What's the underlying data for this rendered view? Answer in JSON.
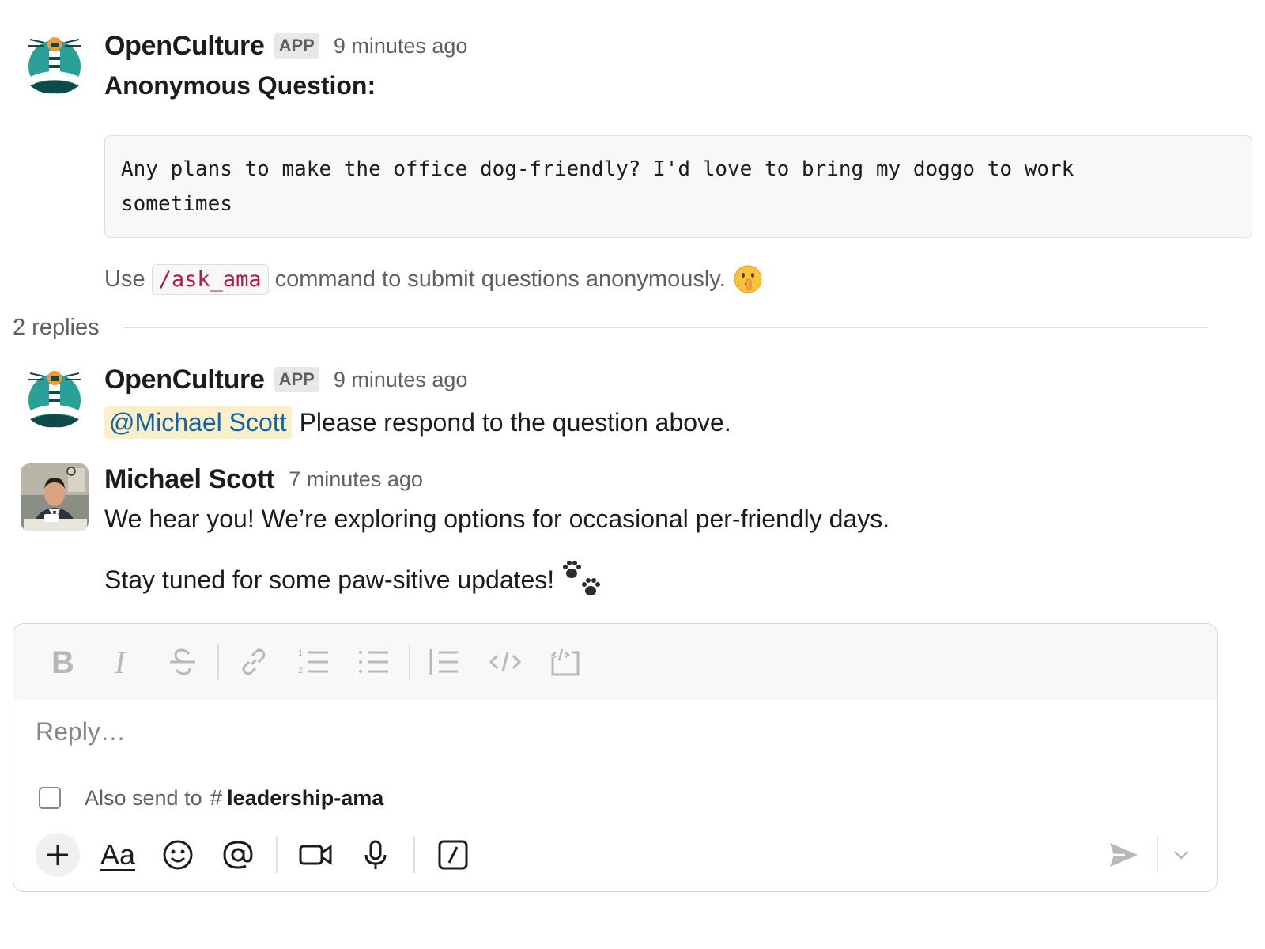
{
  "thread": {
    "messages": [
      {
        "sender": "OpenCulture",
        "badge": "APP",
        "timestamp": "9 minutes ago",
        "title": "Anonymous Question:",
        "code_line1": "Any plans to make the office dog-friendly? I'd love to bring my doggo to work",
        "code_line2": "sometimes",
        "hint_prefix": "Use",
        "hint_command": "/ask_ama",
        "hint_suffix": "command to submit questions anonymously.",
        "hint_emoji": "shushing-face-emoji"
      },
      {
        "sender": "OpenCulture",
        "badge": "APP",
        "timestamp": "9 minutes ago",
        "mention": "@Michael Scott",
        "text": "Please respond to the question above."
      },
      {
        "sender": "Michael Scott",
        "timestamp": "7 minutes ago",
        "para1": "We hear you! We’re exploring options for occasional per-friendly days.",
        "para2": "Stay tuned for some paw-sitive updates!",
        "para2_emoji": "paw-prints-emoji"
      }
    ],
    "replies_label": "2 replies"
  },
  "composer": {
    "placeholder": "Reply…",
    "also_send_label": "Also send to",
    "channel_hash": "#",
    "channel_name": "leadership-ama",
    "format_tools": [
      "bold-icon",
      "italic-icon",
      "strikethrough-icon",
      "link-icon",
      "ordered-list-icon",
      "bulleted-list-icon",
      "blockquote-icon",
      "code-icon",
      "code-block-icon"
    ],
    "action_tools": [
      "plus-icon",
      "formatting-icon",
      "emoji-icon",
      "mention-icon",
      "video-icon",
      "microphone-icon",
      "slash-command-icon"
    ],
    "formatting_label": "Aa"
  },
  "colors": {
    "mention_bg": "#fcefc9",
    "mention_text": "#1264a3",
    "inline_code_text": "#c01343",
    "avatar_teal": "#2aa198",
    "avatar_orange": "#f29a38"
  }
}
